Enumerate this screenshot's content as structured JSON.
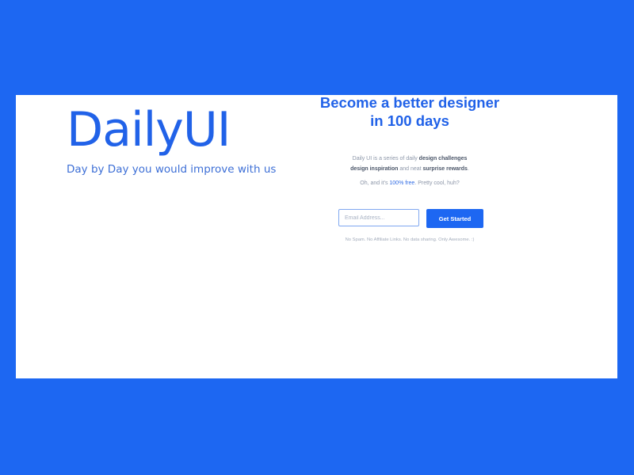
{
  "brand": {
    "logo": "DailyUI",
    "tagline": "Day by Day you would improve with us"
  },
  "signup": {
    "headline_line1": "Become a better designer",
    "headline_line2": "in 100 days",
    "desc_part1": "Daily UI is a series of daily ",
    "desc_highlight1": "design challenges",
    "desc_highlight2": "design inspiration",
    "desc_part2": " and neat ",
    "desc_highlight3": "surprise rewards",
    "desc_part3": ".",
    "note_part1": "Oh, and it's ",
    "note_free": "100% free",
    "note_part2": ". Pretty cool, huh?",
    "email_placeholder": "Email Address...",
    "button_label": "Get Started",
    "disclaimer": "No Spam. No Affiliate Links. No data sharing. Only Awesome. :)"
  },
  "colors": {
    "background": "#1d67f2",
    "card": "#ffffff",
    "accent": "#2162e8"
  }
}
